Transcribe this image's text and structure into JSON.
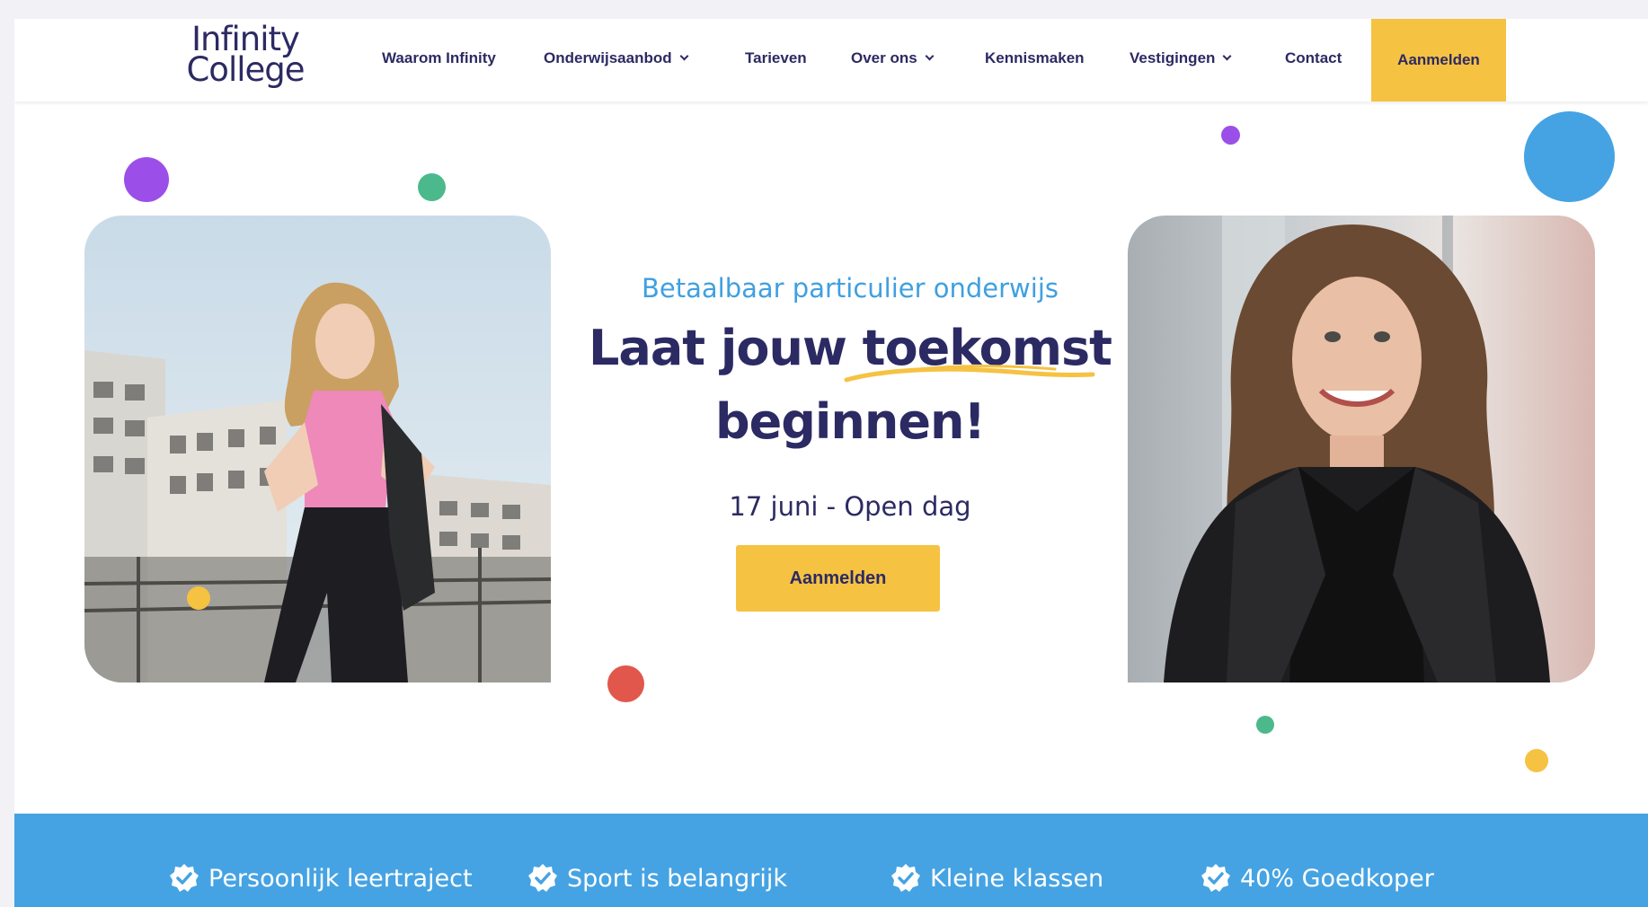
{
  "header": {
    "logo": {
      "line1": "Infinity",
      "line2": "College"
    },
    "nav": [
      {
        "label": "Waarom Infinity",
        "dropdown": false
      },
      {
        "label": "Onderwijsaanbod",
        "dropdown": true
      },
      {
        "label": "Tarieven",
        "dropdown": false
      },
      {
        "label": "Over ons",
        "dropdown": true
      },
      {
        "label": "Kennismaken",
        "dropdown": false
      },
      {
        "label": "Vestigingen",
        "dropdown": true
      },
      {
        "label": "Contact",
        "dropdown": false
      }
    ],
    "cta_label": "Aanmelden"
  },
  "hero": {
    "eyebrow": "Betaalbaar particulier onderwijs",
    "headline_line1": "Laat jouw toekomst",
    "headline_line2": "beginnen!",
    "event": "17 juni - Open dag",
    "cta_label": "Aanmelden"
  },
  "usps": [
    {
      "icon": "check-badge-icon",
      "label": "Persoonlijk leertraject"
    },
    {
      "icon": "check-badge-icon",
      "label": "Sport is belangrijk"
    },
    {
      "icon": "check-badge-icon",
      "label": "Kleine klassen"
    },
    {
      "icon": "check-badge-icon",
      "label": "40% Goedkoper"
    }
  ],
  "colors": {
    "navy": "#2c2a63",
    "yellow": "#f5c242",
    "blue": "#45a3e3",
    "purple": "#9b4fe8",
    "green": "#4bb98c",
    "red": "#e1574b"
  }
}
